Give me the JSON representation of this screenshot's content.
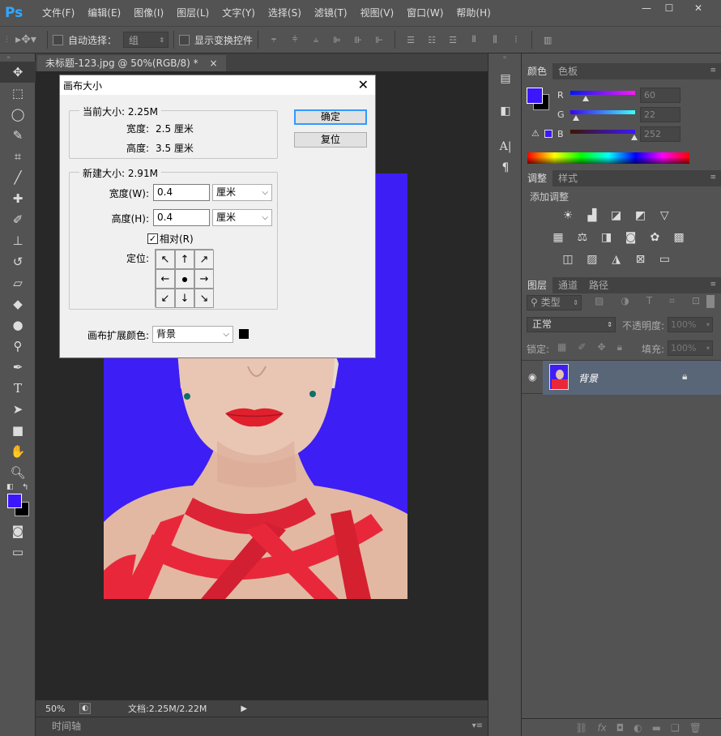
{
  "menubar": {
    "logo": "Ps",
    "items": [
      "文件(F)",
      "编辑(E)",
      "图像(I)",
      "图层(L)",
      "文字(Y)",
      "选择(S)",
      "滤镜(T)",
      "视图(V)",
      "窗口(W)",
      "帮助(H)"
    ],
    "win_min": "—",
    "win_max": "☐",
    "win_close": "✕"
  },
  "optbar": {
    "auto_select_label": "自动选择：",
    "auto_select_value": "组",
    "show_transform_label": "显示变换控件"
  },
  "document": {
    "tab_title": "未标题-123.jpg @ 50%(RGB/8) *",
    "tab_close": "×",
    "zoom": "50%",
    "doc_info": "文档:2.25M/2.22M",
    "timeline_label": "时间轴"
  },
  "dialog": {
    "title": "画布大小",
    "close": "✕",
    "current_size_label": "当前大小: 2.25M",
    "current_width_label": "宽度:",
    "current_width_value": "2.5 厘米",
    "current_height_label": "高度:",
    "current_height_value": "3.5 厘米",
    "new_size_label": "新建大小: 2.91M",
    "width_label": "宽度(W):",
    "width_value": "0.4",
    "width_unit": "厘米",
    "height_label": "高度(H):",
    "height_value": "0.4",
    "height_unit": "厘米",
    "relative_label": "相对(R)",
    "anchor_label": "定位:",
    "anchor_arrows": [
      "↖",
      "↑",
      "↗",
      "←",
      "●",
      "→",
      "↙",
      "↓",
      "↘"
    ],
    "ext_color_label": "画布扩展颜色:",
    "ext_color_value": "背景",
    "ok_button": "确定",
    "reset_button": "复位"
  },
  "color_panel": {
    "tabs": [
      "颜色",
      "色板"
    ],
    "r_label": "R",
    "g_label": "G",
    "b_label": "B",
    "r_value": "60",
    "g_value": "22",
    "b_value": "252",
    "foreground": "#3c16fc",
    "background": "#000000"
  },
  "adjustments_panel": {
    "tabs": [
      "调整",
      "样式"
    ],
    "add_label": "添加调整"
  },
  "layers_panel": {
    "tabs": [
      "图层",
      "通道",
      "路径"
    ],
    "filter_label": "类型",
    "blend_mode": "正常",
    "opacity_label": "不透明度:",
    "opacity_value": "100%",
    "lock_label": "锁定:",
    "fill_label": "填充:",
    "fill_value": "100%",
    "layer_name": "背景"
  },
  "colors": {
    "canvas_bg": "#3d1ef4",
    "dress": "#e8283a",
    "skin": "#e6c1ad"
  }
}
